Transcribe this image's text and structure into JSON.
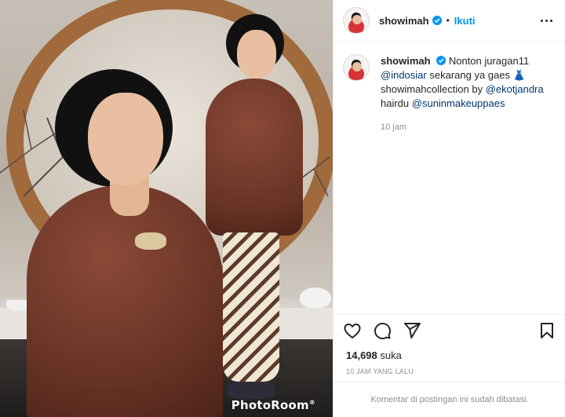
{
  "photo": {
    "watermark": "PhotoRoom",
    "watermark_mark": "®"
  },
  "header": {
    "username": "showimah",
    "separator": "•",
    "follow_label": "Ikuti",
    "more_icon": "more-horizontal-icon",
    "verified_color": "#0095f6"
  },
  "caption": {
    "username": "showimah",
    "text_1": "Nonton juragan11",
    "mention_1": "@indosiar",
    "text_2": "sekarang ya gaes 👗",
    "text_3": "showimahcollection by",
    "mention_2": "@ekotjandra",
    "text_4": "hairdu",
    "mention_3": "@suninmakeuppaes",
    "time": "10 jam"
  },
  "actions": {
    "like_icon": "heart-icon",
    "comment_icon": "comment-icon",
    "share_icon": "send-icon",
    "save_icon": "bookmark-icon"
  },
  "likes": {
    "count": "14,698",
    "label": "suka"
  },
  "posted_time": "10 JAM YANG LALU",
  "comments_disabled": "Komentar di postingan ini sudah dibatasi.",
  "colors": {
    "link": "#00376b",
    "accent": "#0095f6",
    "muted": "#8e8e8e"
  }
}
